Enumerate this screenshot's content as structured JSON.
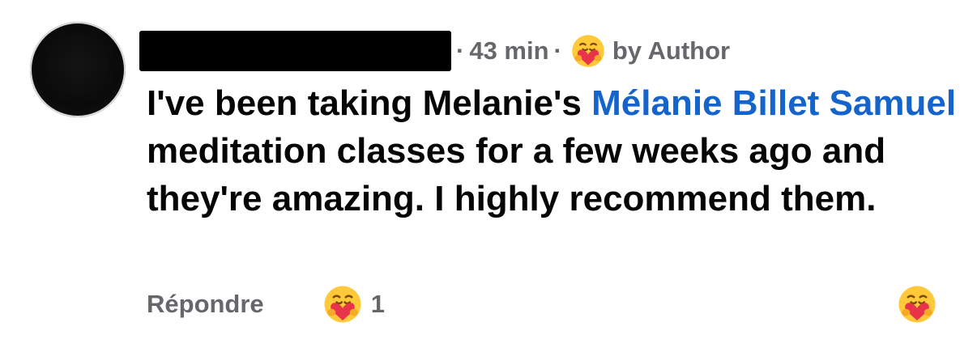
{
  "comment": {
    "author_name_redacted": true,
    "time": "43 min",
    "badge_text": "by Author",
    "badge_icon": "care-emoji-icon",
    "text_before_mention": "I've been taking Melanie's ",
    "mention": "Mélanie Billet Samuel",
    "text_after_mention": " meditation classes for a few weeks ago and they're amazing. I highly recommend them."
  },
  "actions": {
    "reply_label": "Répondre",
    "reaction_icon": "care-emoji-icon",
    "reaction_count": "1",
    "react_button_icon": "care-emoji-icon"
  },
  "separator": "·",
  "colors": {
    "mention": "#1464cc",
    "meta_gray": "#65676b",
    "text": "#050505",
    "emoji_face": "#FFC93A",
    "emoji_heart": "#E8334A"
  }
}
